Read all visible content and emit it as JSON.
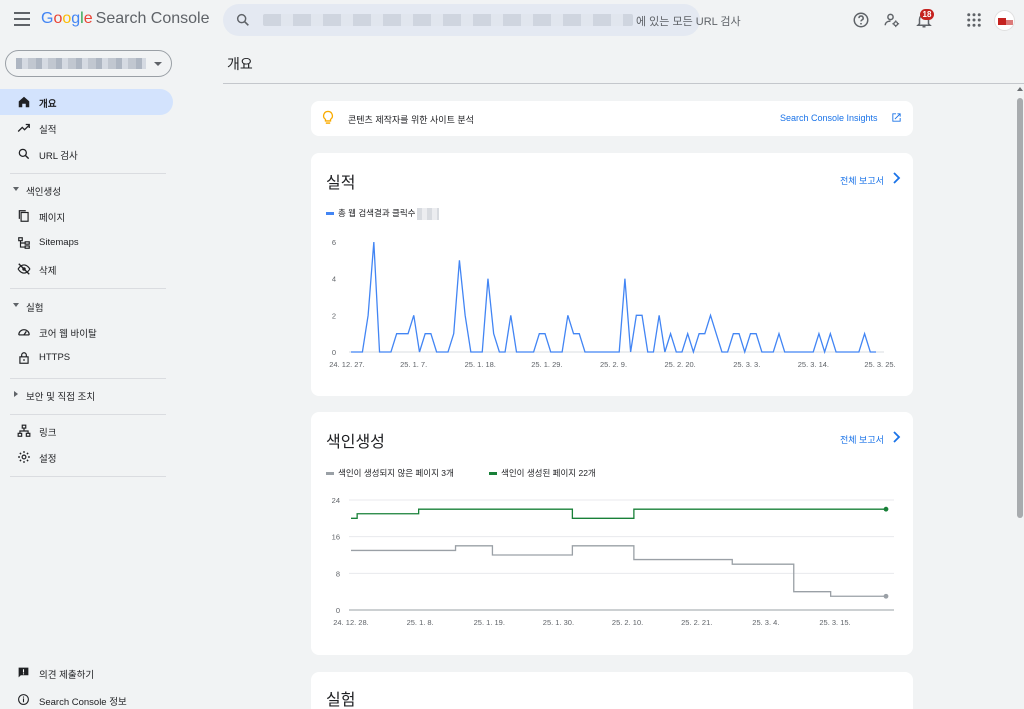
{
  "header": {
    "app_logo": {
      "g": "G",
      "o1": "o",
      "o2": "o",
      "g2": "g",
      "l": "l",
      "e": "e",
      "suffix": "Search Console"
    },
    "search_placeholder": "에 있는 모든 URL 검사",
    "notifications_count": "18"
  },
  "sidebar": {
    "property_selector": "",
    "items_top": [
      {
        "label": "개요",
        "icon": "home-icon",
        "active": true
      },
      {
        "label": "실적",
        "icon": "trending-up-icon"
      },
      {
        "label": "URL 검사",
        "icon": "search-icon"
      }
    ],
    "sections": [
      {
        "label": "색인생성",
        "expanded": true,
        "items": [
          {
            "label": "페이지",
            "icon": "pages-icon"
          },
          {
            "label": "Sitemaps",
            "icon": "sitemap-icon"
          },
          {
            "label": "삭제",
            "icon": "eye-off-icon"
          }
        ]
      },
      {
        "label": "실험",
        "expanded": true,
        "items": [
          {
            "label": "코어 웹 바이탈",
            "icon": "speedometer-icon"
          },
          {
            "label": "HTTPS",
            "icon": "lock-icon"
          }
        ]
      },
      {
        "label": "보안 및 직접 조치",
        "expanded": false,
        "items": []
      }
    ],
    "items_bottom": [
      {
        "label": "링크",
        "icon": "links-icon"
      },
      {
        "label": "설정",
        "icon": "gear-icon"
      }
    ],
    "footer": [
      {
        "label": "의견 제출하기",
        "icon": "feedback-icon"
      },
      {
        "label": "Search Console 정보",
        "icon": "info-icon"
      }
    ]
  },
  "main": {
    "page_title": "개요",
    "insights_banner": {
      "text": "콘텐츠 제작자를 위한 사이트 분석",
      "link": "Search Console Insights"
    },
    "performance_card": {
      "title": "실적",
      "report_link": "전체 보고서",
      "legend": "총 웹 검색결과 클릭수"
    },
    "indexing_card": {
      "title": "색인생성",
      "report_link": "전체 보고서",
      "legend_not_indexed": "색인이 생성되지 않은 페이지 3개",
      "legend_indexed": "색인이 생성된 페이지 22개"
    },
    "experience_card": {
      "title": "실험"
    }
  },
  "colors": {
    "accent_blue": "#1a73e8",
    "clicks_line": "#4285f4",
    "indexed_line": "#188038",
    "not_indexed_line": "#9aa0a6",
    "active_nav": "#d3e3fd"
  },
  "chart_data": [
    {
      "type": "line",
      "title": "실적",
      "series": [
        {
          "name": "총 웹 검색결과 클릭수",
          "values": [
            0,
            0,
            0,
            2,
            6,
            0,
            0,
            0,
            1,
            1,
            1,
            2,
            0,
            1,
            1,
            0,
            0,
            0,
            1,
            5,
            2,
            0,
            0,
            0,
            4,
            1,
            0,
            0,
            2,
            0,
            0,
            0,
            0,
            1,
            1,
            0,
            0,
            0,
            2,
            1,
            1,
            0,
            0,
            0,
            0,
            0,
            0,
            0,
            4,
            0,
            2,
            2,
            0,
            0,
            2,
            0,
            1,
            0,
            0,
            1,
            0,
            1,
            1,
            2,
            1,
            0,
            0,
            1,
            1,
            0,
            1,
            1,
            0,
            0,
            0,
            1,
            0,
            0,
            0,
            0,
            0,
            0,
            1,
            0,
            1,
            0,
            0,
            0,
            0,
            0,
            1,
            0,
            0
          ]
        }
      ],
      "x_tick_labels": [
        "24. 12. 27.",
        "25. 1. 7.",
        "25. 1. 18.",
        "25. 1. 29.",
        "25. 2. 9.",
        "25. 2. 20.",
        "25. 3. 3.",
        "25. 3. 14.",
        "25. 3. 25."
      ],
      "y_ticks": [
        0,
        2,
        4,
        6
      ],
      "ylim": [
        0,
        6
      ],
      "grid": false
    },
    {
      "type": "line",
      "title": "색인생성",
      "series": [
        {
          "name": "색인이 생성된 페이지 22개",
          "values": [
            20,
            21,
            21,
            21,
            21,
            21,
            21,
            21,
            21,
            21,
            21,
            22,
            22,
            22,
            22,
            22,
            22,
            22,
            22,
            22,
            22,
            22,
            22,
            22,
            22,
            22,
            22,
            22,
            22,
            22,
            22,
            22,
            22,
            22,
            22,
            22,
            20,
            20,
            20,
            20,
            20,
            20,
            20,
            20,
            20,
            20,
            22,
            22,
            22,
            22,
            22,
            22,
            22,
            22,
            22,
            22,
            22,
            22,
            22,
            22,
            22,
            22,
            22,
            22,
            22,
            22,
            22,
            22,
            22,
            22,
            22,
            22,
            22,
            22,
            22,
            22,
            22,
            22,
            22,
            22,
            22,
            22,
            22,
            22,
            22,
            22,
            22,
            22
          ]
        },
        {
          "name": "색인이 생성되지 않은 페이지 3개",
          "values": [
            13,
            13,
            13,
            13,
            13,
            13,
            13,
            13,
            13,
            13,
            13,
            13,
            13,
            13,
            13,
            13,
            13,
            14,
            14,
            14,
            14,
            14,
            14,
            12,
            12,
            12,
            12,
            12,
            12,
            12,
            12,
            12,
            12,
            12,
            12,
            12,
            14,
            14,
            14,
            14,
            14,
            14,
            14,
            14,
            14,
            14,
            11,
            11,
            11,
            11,
            11,
            11,
            11,
            11,
            11,
            11,
            11,
            11,
            11,
            11,
            11,
            11,
            10,
            10,
            10,
            10,
            10,
            10,
            10,
            10,
            10,
            10,
            4,
            4,
            4,
            4,
            4,
            4,
            3,
            3,
            3,
            3,
            3,
            3,
            3,
            3,
            3,
            3
          ]
        }
      ],
      "x_tick_labels": [
        "24. 12. 28.",
        "25. 1. 8.",
        "25. 1. 19.",
        "25. 1. 30.",
        "25. 2. 10.",
        "25. 2. 21.",
        "25. 3. 4.",
        "25. 3. 15."
      ],
      "y_ticks": [
        0,
        8,
        16,
        24
      ],
      "ylim": [
        0,
        24
      ],
      "grid": true
    }
  ]
}
